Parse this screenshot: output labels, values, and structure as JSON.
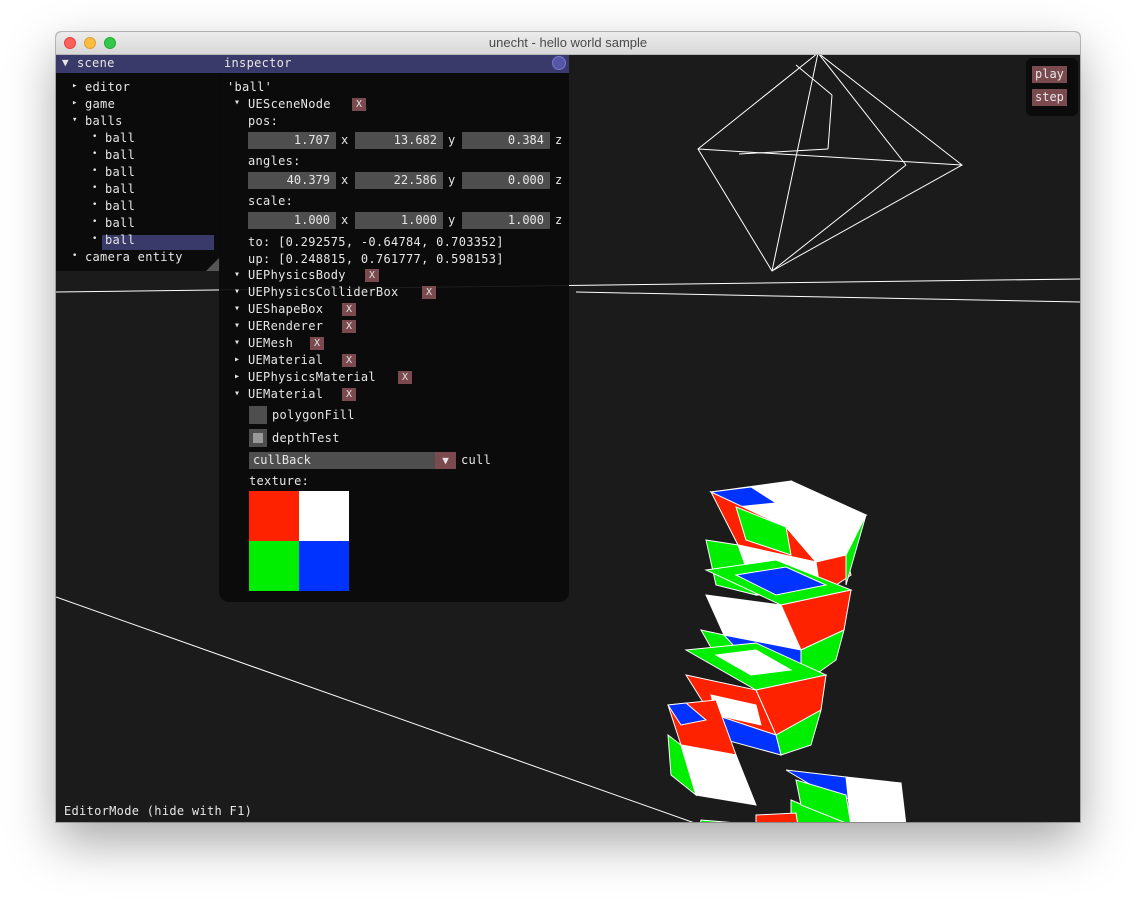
{
  "window": {
    "title": "unecht - hello world sample"
  },
  "scene_panel": {
    "header": "scene",
    "tree": [
      {
        "label": "editor",
        "bullet": "▸"
      },
      {
        "label": "game",
        "bullet": "▸"
      },
      {
        "label": "balls",
        "bullet": "▾"
      },
      {
        "label": "ball",
        "bullet": "•"
      },
      {
        "label": "ball",
        "bullet": "•"
      },
      {
        "label": "ball",
        "bullet": "•"
      },
      {
        "label": "ball",
        "bullet": "•"
      },
      {
        "label": "ball",
        "bullet": "•"
      },
      {
        "label": "ball",
        "bullet": "•"
      },
      {
        "label": "ball",
        "bullet": "•",
        "selected": true
      },
      {
        "label": "camera entity",
        "bullet": "•"
      }
    ]
  },
  "inspector": {
    "header": "inspector",
    "object_name": "'ball'",
    "scene_node": {
      "label": "UESceneNode",
      "pos_label": "pos:",
      "pos": [
        "1.707",
        "13.682",
        "0.384"
      ],
      "angles_label": "angles:",
      "angles": [
        "40.379",
        "22.586",
        "0.000"
      ],
      "scale_label": "scale:",
      "scale": [
        "1.000",
        "1.000",
        "1.000"
      ],
      "axis": [
        "x",
        "y",
        "z"
      ],
      "to": "to: [0.292575, -0.64784, 0.703352]",
      "up": "up: [0.248815, 0.761777, 0.598153]"
    },
    "components": [
      {
        "label": "UEPhysicsBody",
        "arrow": "▾"
      },
      {
        "label": "UEPhysicsColliderBox",
        "arrow": "▾"
      },
      {
        "label": "UEShapeBox",
        "arrow": "▾"
      },
      {
        "label": "UERenderer",
        "arrow": "▾"
      },
      {
        "label": "UEMesh",
        "arrow": "▾"
      },
      {
        "label": "UEMaterial",
        "arrow": "▸"
      },
      {
        "label": "UEPhysicsMaterial",
        "arrow": "▸"
      },
      {
        "label": "UEMaterial",
        "arrow": "▾"
      }
    ],
    "material": {
      "polygon_fill": "polygonFill",
      "polygon_fill_checked": false,
      "depth_test": "depthTest",
      "depth_test_checked": true,
      "cull_value": "cullBack",
      "cull_label": "cull",
      "texture_label": "texture:",
      "texture_colors": [
        "#ff2200",
        "#ffffff",
        "#00ee00",
        "#0033ff"
      ]
    },
    "remove_glyph": "X"
  },
  "controls": {
    "play": "play",
    "step": "step"
  },
  "status": "EditorMode (hide with F1)",
  "icons": {
    "collapse": "▼",
    "dropdown": "▼"
  }
}
